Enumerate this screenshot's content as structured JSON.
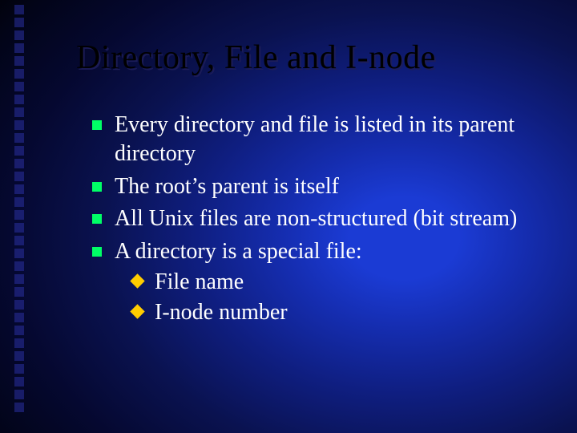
{
  "title": "Directory, File and I-node",
  "bullets": {
    "b1": "Every directory and file is listed in its parent directory",
    "b2": "The root’s parent is itself",
    "b3": "All Unix files are non-structured (bit stream)",
    "b4": "A directory is a special file:",
    "b4_sub": {
      "s1": "File name",
      "s2": "I-node number"
    }
  }
}
